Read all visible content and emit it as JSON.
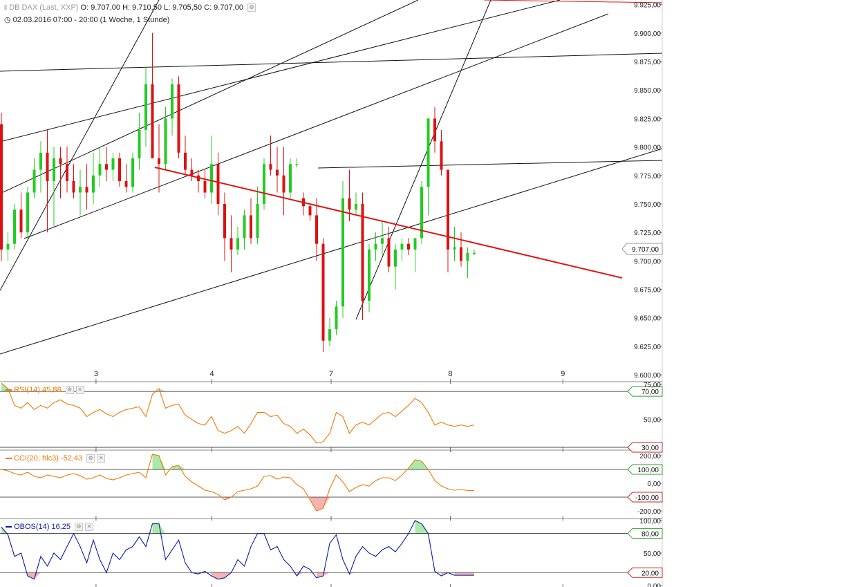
{
  "header": {
    "instrument": "DB DAX",
    "feed": "(Last, XXP)",
    "ohlc": "O: 9.707,00  H: 9.710,50  L: 9.705,50  C: 9.707,00",
    "range": "02.03.2016 07:00 - 20:00 (1 Woche, 1 Stunde)"
  },
  "colors": {
    "up": "#22cc22",
    "down": "#dd1111",
    "trend_red": "#e01414",
    "rsi": "#f07800",
    "cci": "#f07800",
    "obos": "#0a1aa0",
    "pos_fill": "#8fe08f",
    "neg_fill": "#f29a9a"
  },
  "chart_data": [
    {
      "type": "candlestick",
      "title": "DB DAX",
      "last_price_label": "9.707,00",
      "x_tick_labels": [
        "3",
        "4",
        "7",
        "8",
        "9"
      ],
      "x_tick_positions": [
        14.5,
        32,
        50,
        68,
        85
      ],
      "y_ticks": [
        "9.925,00",
        "9.900,00",
        "9.875,00",
        "9.850,00",
        "9.825,00",
        "9.800,00",
        "9.775,00",
        "9.750,00",
        "9.725,00",
        "9.700,00",
        "9.675,00",
        "9.650,00",
        "9.625,00",
        "9.600,00"
      ],
      "ylim": [
        9594,
        9929
      ],
      "candles": [
        [
          9820,
          9830,
          9700,
          9710
        ],
        [
          9710,
          9725,
          9700,
          9715
        ],
        [
          9715,
          9750,
          9710,
          9745
        ],
        [
          9745,
          9760,
          9720,
          9725
        ],
        [
          9725,
          9765,
          9720,
          9760
        ],
        [
          9760,
          9790,
          9755,
          9780
        ],
        [
          9780,
          9805,
          9760,
          9795
        ],
        [
          9795,
          9815,
          9725,
          9770
        ],
        [
          9770,
          9800,
          9730,
          9790
        ],
        [
          9790,
          9800,
          9755,
          9785
        ],
        [
          9785,
          9800,
          9760,
          9770
        ],
        [
          9770,
          9785,
          9755,
          9760
        ],
        [
          9760,
          9780,
          9740,
          9765
        ],
        [
          9765,
          9785,
          9745,
          9760
        ],
        [
          9760,
          9795,
          9750,
          9775
        ],
        [
          9775,
          9800,
          9765,
          9785
        ],
        [
          9785,
          9800,
          9770,
          9780
        ],
        [
          9780,
          9795,
          9770,
          9790
        ],
        [
          9790,
          9795,
          9765,
          9770
        ],
        [
          9770,
          9785,
          9760,
          9765
        ],
        [
          9765,
          9795,
          9760,
          9790
        ],
        [
          9790,
          9830,
          9780,
          9815
        ],
        [
          9815,
          9870,
          9800,
          9855
        ],
        [
          9855,
          9900,
          9840,
          9790
        ],
        [
          9790,
          9820,
          9760,
          9785
        ],
        [
          9785,
          9835,
          9780,
          9825
        ],
        [
          9825,
          9860,
          9810,
          9855
        ],
        [
          9855,
          9862,
          9790,
          9795
        ],
        [
          9795,
          9810,
          9775,
          9780
        ],
        [
          9780,
          9790,
          9770,
          9775
        ],
        [
          9775,
          9780,
          9760,
          9770
        ],
        [
          9770,
          9780,
          9755,
          9760
        ],
        [
          9760,
          9810,
          9750,
          9785
        ],
        [
          9785,
          9795,
          9740,
          9750
        ],
        [
          9750,
          9760,
          9700,
          9720
        ],
        [
          9720,
          9740,
          9690,
          9710
        ],
        [
          9710,
          9730,
          9705,
          9720
        ],
        [
          9720,
          9745,
          9710,
          9740
        ],
        [
          9740,
          9755,
          9715,
          9720
        ],
        [
          9720,
          9765,
          9715,
          9750
        ],
        [
          9750,
          9790,
          9745,
          9785
        ],
        [
          9785,
          9810,
          9775,
          9780
        ],
        [
          9780,
          9800,
          9760,
          9775
        ],
        [
          9775,
          9800,
          9740,
          9760
        ],
        [
          9760,
          9790,
          9755,
          9785
        ],
        [
          9785,
          9790,
          9782,
          9785
        ],
        [
          9755,
          9760,
          9740,
          9748
        ],
        [
          9748,
          9750,
          9735,
          9740
        ],
        [
          9740,
          9755,
          9700,
          9715
        ],
        [
          9715,
          9720,
          9620,
          9630
        ],
        [
          9630,
          9650,
          9625,
          9640
        ],
        [
          9640,
          9665,
          9635,
          9660
        ],
        [
          9660,
          9770,
          9650,
          9755
        ],
        [
          9755,
          9780,
          9735,
          9745
        ],
        [
          9745,
          9760,
          9740,
          9750
        ],
        [
          9750,
          9760,
          9648,
          9665
        ],
        [
          9665,
          9715,
          9655,
          9710
        ],
        [
          9710,
          9725,
          9700,
          9715
        ],
        [
          9715,
          9735,
          9705,
          9720
        ],
        [
          9720,
          9730,
          9690,
          9695
        ],
        [
          9695,
          9715,
          9675,
          9710
        ],
        [
          9710,
          9720,
          9700,
          9715
        ],
        [
          9715,
          9720,
          9705,
          9710
        ],
        [
          9710,
          9720,
          9690,
          9720
        ],
        [
          9720,
          9770,
          9715,
          9765
        ],
        [
          9765,
          9825,
          9740,
          9825
        ],
        [
          9825,
          9835,
          9795,
          9805
        ],
        [
          9805,
          9815,
          9775,
          9780
        ],
        [
          9780,
          9780,
          9690,
          9710
        ],
        [
          9710,
          9730,
          9700,
          9712
        ],
        [
          9712,
          9725,
          9695,
          9700
        ],
        [
          9700,
          9712,
          9685,
          9707
        ],
        [
          9707,
          9710,
          9705,
          9707
        ]
      ]
    },
    {
      "type": "line",
      "name": "RSI(14)",
      "value_label": "45,88",
      "ylim": [
        28,
        77
      ],
      "y_tick_labels": [
        "75,00",
        "50,00"
      ],
      "ref_levels": [
        {
          "value": 70,
          "label": "70,00"
        },
        {
          "value": 30,
          "label": "30,00"
        }
      ],
      "values": [
        76,
        72,
        60,
        58,
        62,
        57,
        60,
        58,
        62,
        64,
        61,
        60,
        58,
        52,
        55,
        57,
        54,
        52,
        55,
        57,
        58,
        59,
        52,
        68,
        72,
        58,
        60,
        61,
        53,
        50,
        47,
        46,
        52,
        42,
        40,
        42,
        45,
        40,
        47,
        55,
        55,
        52,
        53,
        47,
        45,
        40,
        43,
        39,
        33,
        34,
        40,
        55,
        52,
        40,
        46,
        48,
        46,
        50,
        54,
        55,
        52,
        56,
        60,
        65,
        62,
        55,
        46,
        48,
        46,
        45,
        46,
        45,
        46
      ],
      "pos_fill_threshold": 70,
      "neg_fill_threshold": 30
    },
    {
      "type": "line",
      "name": "CCI(20, hlc3)",
      "value_label": "-52,43",
      "ylim": [
        -255,
        240
      ],
      "y_tick_labels": [
        "200,00",
        "0,00",
        "-200,00"
      ],
      "ref_levels": [
        {
          "value": 100,
          "label": "100,00"
        },
        {
          "value": -100,
          "label": "-100,00"
        }
      ],
      "values": [
        100,
        90,
        70,
        60,
        80,
        50,
        40,
        60,
        50,
        40,
        60,
        70,
        55,
        30,
        40,
        60,
        35,
        25,
        40,
        60,
        70,
        80,
        40,
        210,
        200,
        60,
        120,
        130,
        50,
        10,
        -20,
        -50,
        -60,
        -80,
        -120,
        -100,
        -60,
        -50,
        -40,
        -20,
        50,
        55,
        30,
        45,
        40,
        -10,
        -40,
        -120,
        -200,
        -180,
        -40,
        60,
        10,
        -60,
        -30,
        -10,
        -20,
        20,
        40,
        40,
        20,
        60,
        110,
        170,
        160,
        100,
        20,
        -20,
        -40,
        -50,
        -45,
        -52,
        -52
      ],
      "pos_fill_threshold": 100,
      "neg_fill_threshold": -100
    },
    {
      "type": "line",
      "name": "OBOS(14)",
      "value_label": "16,25",
      "ylim": [
        -2,
        103
      ],
      "y_tick_labels": [
        "100,00",
        "50,00",
        "0,00"
      ],
      "ref_levels": [
        {
          "value": 80,
          "label": "80,00"
        },
        {
          "value": 20,
          "label": "20,00"
        }
      ],
      "values": [
        90,
        78,
        45,
        50,
        15,
        10,
        45,
        30,
        50,
        40,
        60,
        80,
        60,
        35,
        70,
        40,
        20,
        50,
        40,
        55,
        60,
        75,
        60,
        95,
        95,
        40,
        55,
        70,
        35,
        20,
        18,
        22,
        15,
        10,
        12,
        20,
        40,
        30,
        60,
        80,
        80,
        55,
        60,
        40,
        30,
        15,
        30,
        25,
        12,
        15,
        65,
        78,
        40,
        18,
        45,
        60,
        50,
        45,
        55,
        60,
        52,
        65,
        80,
        100,
        95,
        80,
        22,
        15,
        20,
        16,
        16,
        16,
        16
      ],
      "pos_fill_threshold": 80,
      "neg_fill_threshold": 20
    }
  ]
}
